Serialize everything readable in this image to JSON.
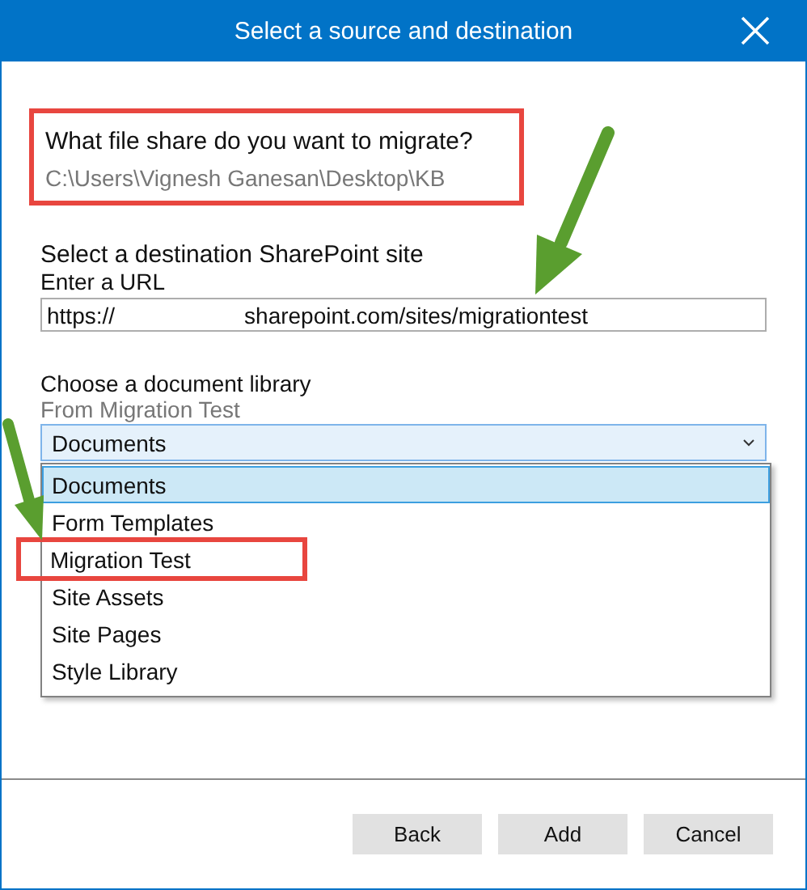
{
  "window": {
    "title": "Select a source and destination"
  },
  "source": {
    "question": "What file share do you want to migrate?",
    "path": "C:\\Users\\Vignesh Ganesan\\Desktop\\KB",
    "highlighted": true
  },
  "destination": {
    "heading": "Select a destination SharePoint site",
    "url_label": "Enter a URL",
    "url_value_start": "https://",
    "url_value_end": "sharepoint.com/sites/migrationtest"
  },
  "library": {
    "heading": "Choose a document library",
    "subheading": "From Migration Test",
    "dropdown_value": "Documents",
    "expanded": true,
    "options": [
      {
        "label": "Documents",
        "selected": true,
        "highlighted": false
      },
      {
        "label": "Form Templates",
        "selected": false,
        "highlighted": false
      },
      {
        "label": "Migration Test",
        "selected": false,
        "highlighted": true
      },
      {
        "label": "Site Assets",
        "selected": false,
        "highlighted": false
      },
      {
        "label": "Site Pages",
        "selected": false,
        "highlighted": false
      },
      {
        "label": "Style Library",
        "selected": false,
        "highlighted": false
      }
    ]
  },
  "buttons": [
    {
      "label": "Back"
    },
    {
      "label": "Add"
    },
    {
      "label": "Cancel"
    }
  ]
}
